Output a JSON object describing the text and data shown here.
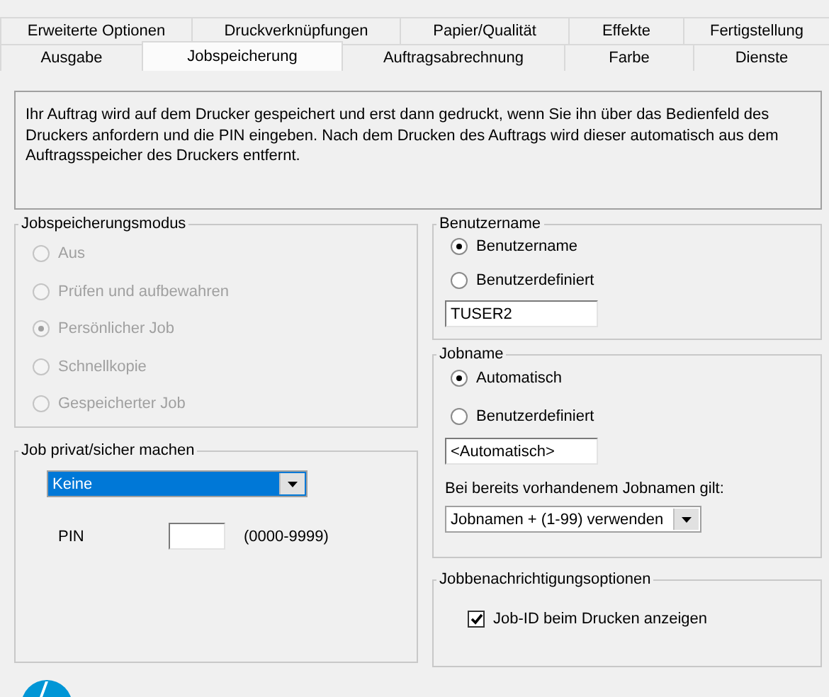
{
  "tabs_row_1": [
    {
      "label": "Erweiterte Optionen",
      "selected": false
    },
    {
      "label": "Druckverknüpfungen",
      "selected": false
    },
    {
      "label": "Papier/Qualität",
      "selected": false
    },
    {
      "label": "Effekte",
      "selected": false
    },
    {
      "label": "Fertigstellung",
      "selected": false
    }
  ],
  "tabs_row_2": [
    {
      "label": "Ausgabe",
      "selected": false
    },
    {
      "label": "Jobspeicherung",
      "selected": true
    },
    {
      "label": "Auftragsabrechnung",
      "selected": false
    },
    {
      "label": "Farbe",
      "selected": false
    },
    {
      "label": "Dienste",
      "selected": false
    }
  ],
  "description": "Ihr Auftrag wird auf dem Drucker gespeichert und erst dann gedruckt, wenn Sie ihn über das Bedienfeld des Druckers anfordern und die PIN eingeben. Nach dem Drucken des Auftrags wird dieser automatisch aus dem Auftragsspeicher des Druckers entfernt.",
  "storage_mode": {
    "title": "Jobspeicherungsmodus",
    "options": [
      {
        "label": "Aus",
        "selected": false,
        "disabled": true
      },
      {
        "label": "Prüfen und aufbewahren",
        "selected": false,
        "disabled": true
      },
      {
        "label": "Persönlicher Job",
        "selected": true,
        "disabled": true
      },
      {
        "label": "Schnellkopie",
        "selected": false,
        "disabled": true
      },
      {
        "label": "Gespeicherter Job",
        "selected": false,
        "disabled": true
      }
    ]
  },
  "make_private": {
    "title": "Job privat/sicher machen",
    "dropdown": {
      "value": "Keine",
      "highlighted": true
    },
    "pin": {
      "label": "PIN",
      "range": "(0000-9999)"
    }
  },
  "user_name": {
    "title": "Benutzername",
    "options": [
      {
        "label": "Benutzername",
        "selected": true,
        "disabled": false
      },
      {
        "label": "Benutzerdefiniert",
        "selected": false,
        "disabled": false
      }
    ],
    "field": {
      "value": "TUSER2"
    }
  },
  "job_name": {
    "title": "Jobname",
    "options": [
      {
        "label": "Automatisch",
        "selected": true,
        "disabled": false
      },
      {
        "label": "Benutzerdefiniert",
        "selected": false,
        "disabled": false
      }
    ],
    "field": {
      "value": "<Automatisch>"
    },
    "duplicate_label": "Bei bereits vorhandenem Jobnamen gilt:",
    "duplicate_dropdown": {
      "value": "Jobnamen + (1-99) verwenden",
      "highlighted": false
    }
  },
  "notification": {
    "title": "Jobbenachrichtigungsoptionen",
    "checkbox": {
      "label": "Job-ID beim Drucken anzeigen",
      "checked": true
    }
  }
}
